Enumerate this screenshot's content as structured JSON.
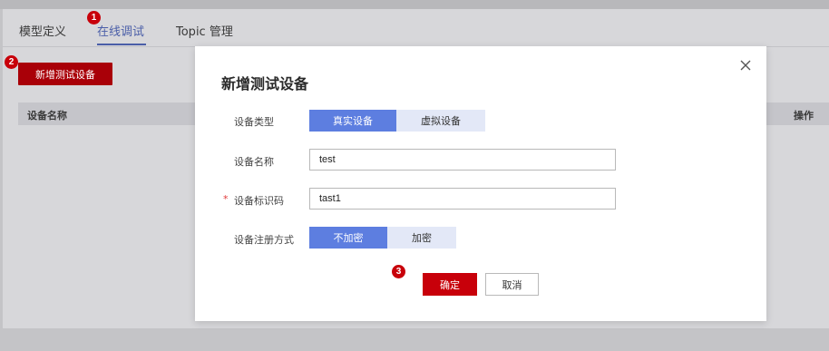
{
  "tabs": [
    {
      "label": "模型定义"
    },
    {
      "label": "在线调试"
    },
    {
      "label": "Topic 管理"
    }
  ],
  "badges": [
    "1",
    "2",
    "3"
  ],
  "toolbar": {
    "add_label": "新增测试设备"
  },
  "table": {
    "headers": [
      "设备名称",
      "操作"
    ]
  },
  "modal": {
    "title": "新增测试设备",
    "device_type": {
      "label": "设备类型",
      "options": [
        "真实设备",
        "虚拟设备"
      ],
      "selected": "真实设备"
    },
    "device_name": {
      "label": "设备名称",
      "value": "test"
    },
    "device_id": {
      "required_mark": "*",
      "label": "设备标识码",
      "value": "tast1"
    },
    "register_mode": {
      "label": "设备注册方式",
      "options": [
        "不加密",
        "加密"
      ],
      "selected": "不加密"
    },
    "ok_label": "确定",
    "cancel_label": "取消"
  },
  "colors": {
    "accent_red": "#c8000a",
    "accent_blue": "#5d7ee0",
    "tab_active": "#4a5ea8"
  }
}
